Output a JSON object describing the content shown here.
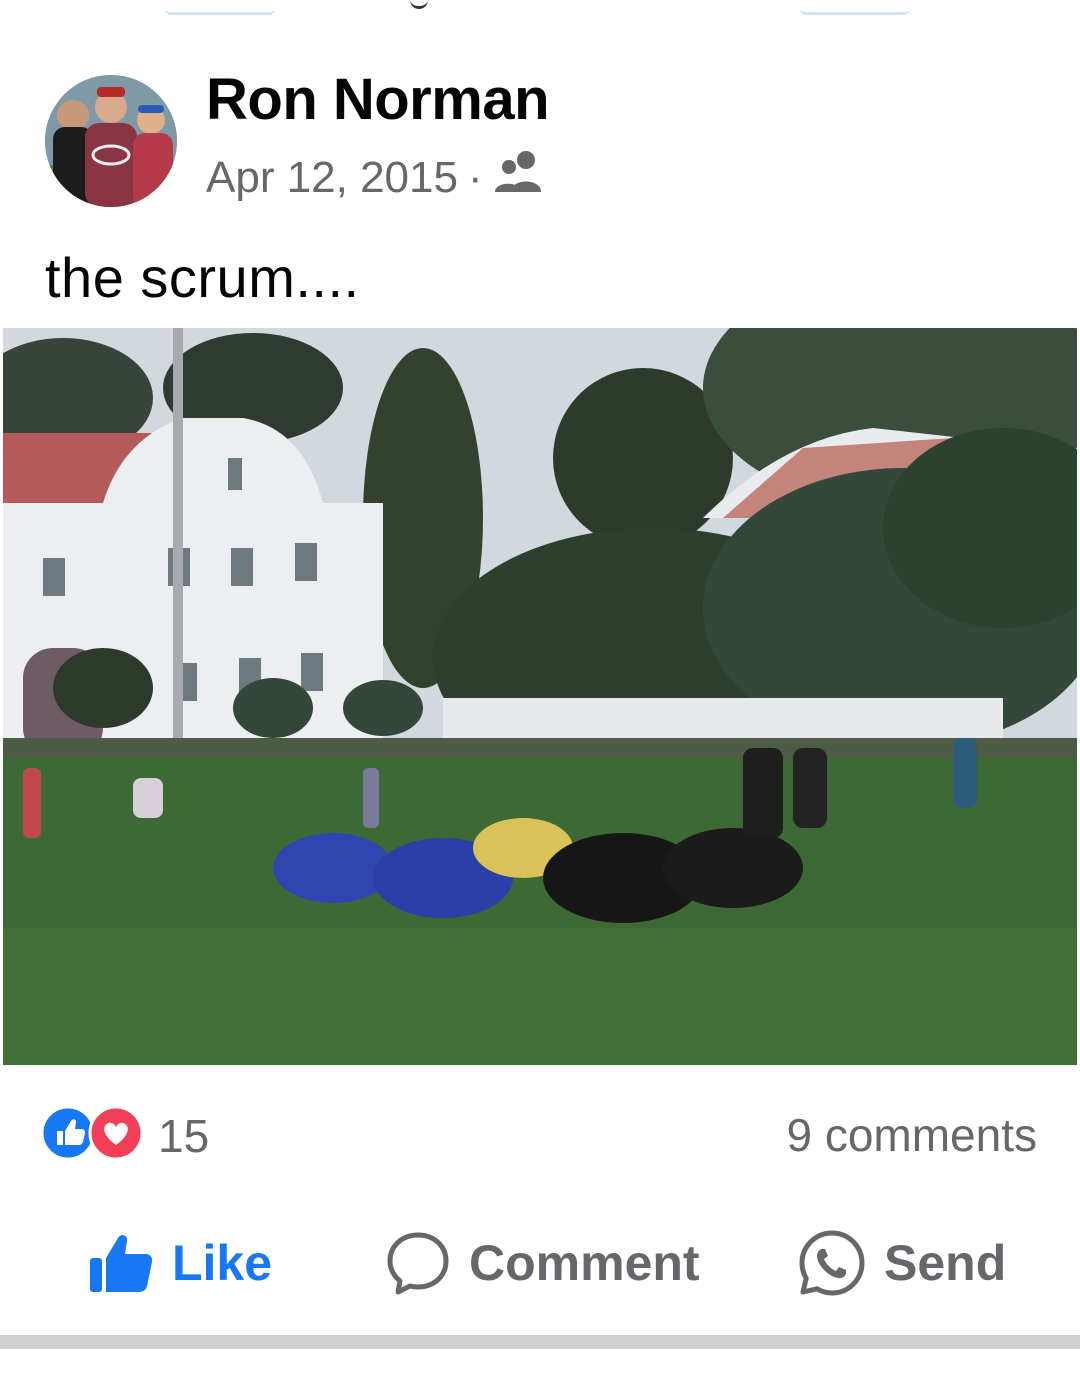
{
  "post": {
    "author": "Ron Norman",
    "date": "Apr 12, 2015",
    "separator": "·",
    "audience_icon": "friends-icon",
    "text": "the scrum...."
  },
  "stats": {
    "reaction_count": "15",
    "comments": "9 comments"
  },
  "actions": {
    "like": "Like",
    "comment": "Comment",
    "send": "Send"
  },
  "colors": {
    "like_blue": "#1877f2",
    "love_red": "#f33e58",
    "secondary_text": "#65676b"
  }
}
